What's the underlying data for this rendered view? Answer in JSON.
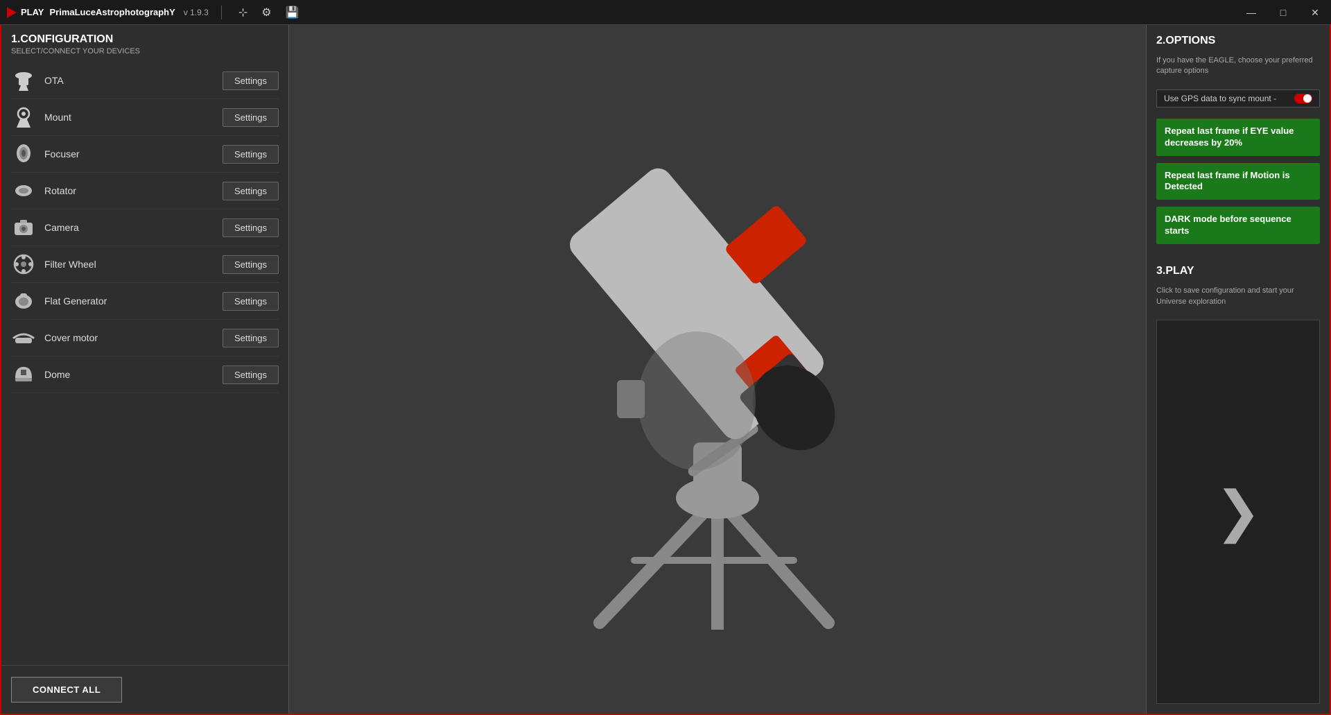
{
  "titlebar": {
    "play_label": "PLAY",
    "app_name": "PrimaLuceAstrophotographY",
    "version": "v 1.9.3"
  },
  "winControls": {
    "minimize": "—",
    "maximize": "□",
    "close": "✕"
  },
  "left": {
    "section_title": "1.CONFIGURATION",
    "section_subtitle": "SELECT/CONNECT YOUR DEVICES",
    "devices": [
      {
        "name": "OTA",
        "icon": "ota"
      },
      {
        "name": "Mount",
        "icon": "mount"
      },
      {
        "name": "Focuser",
        "icon": "focuser"
      },
      {
        "name": "Rotator",
        "icon": "rotator"
      },
      {
        "name": "Camera",
        "icon": "camera"
      },
      {
        "name": "Filter Wheel",
        "icon": "filterwheel"
      },
      {
        "name": "Flat Generator",
        "icon": "flatgenerator"
      },
      {
        "name": "Cover motor",
        "icon": "covermotor"
      },
      {
        "name": "Dome",
        "icon": "dome"
      }
    ],
    "settings_label": "Settings",
    "connect_all_label": "CONNECT ALL"
  },
  "right": {
    "options_title": "2.OPTIONS",
    "options_desc": "If you have the EAGLE, choose your preferred capture options",
    "gps_label": "Use GPS data to sync mount -",
    "option1": "Repeat last frame if EYE value decreases by 20%",
    "option2": "Repeat last frame if Motion is Detected",
    "option3": "DARK mode before sequence starts",
    "play_title": "3.PLAY",
    "play_desc": "Click to save configuration and start your Universe exploration",
    "play_chevron": "❯"
  }
}
